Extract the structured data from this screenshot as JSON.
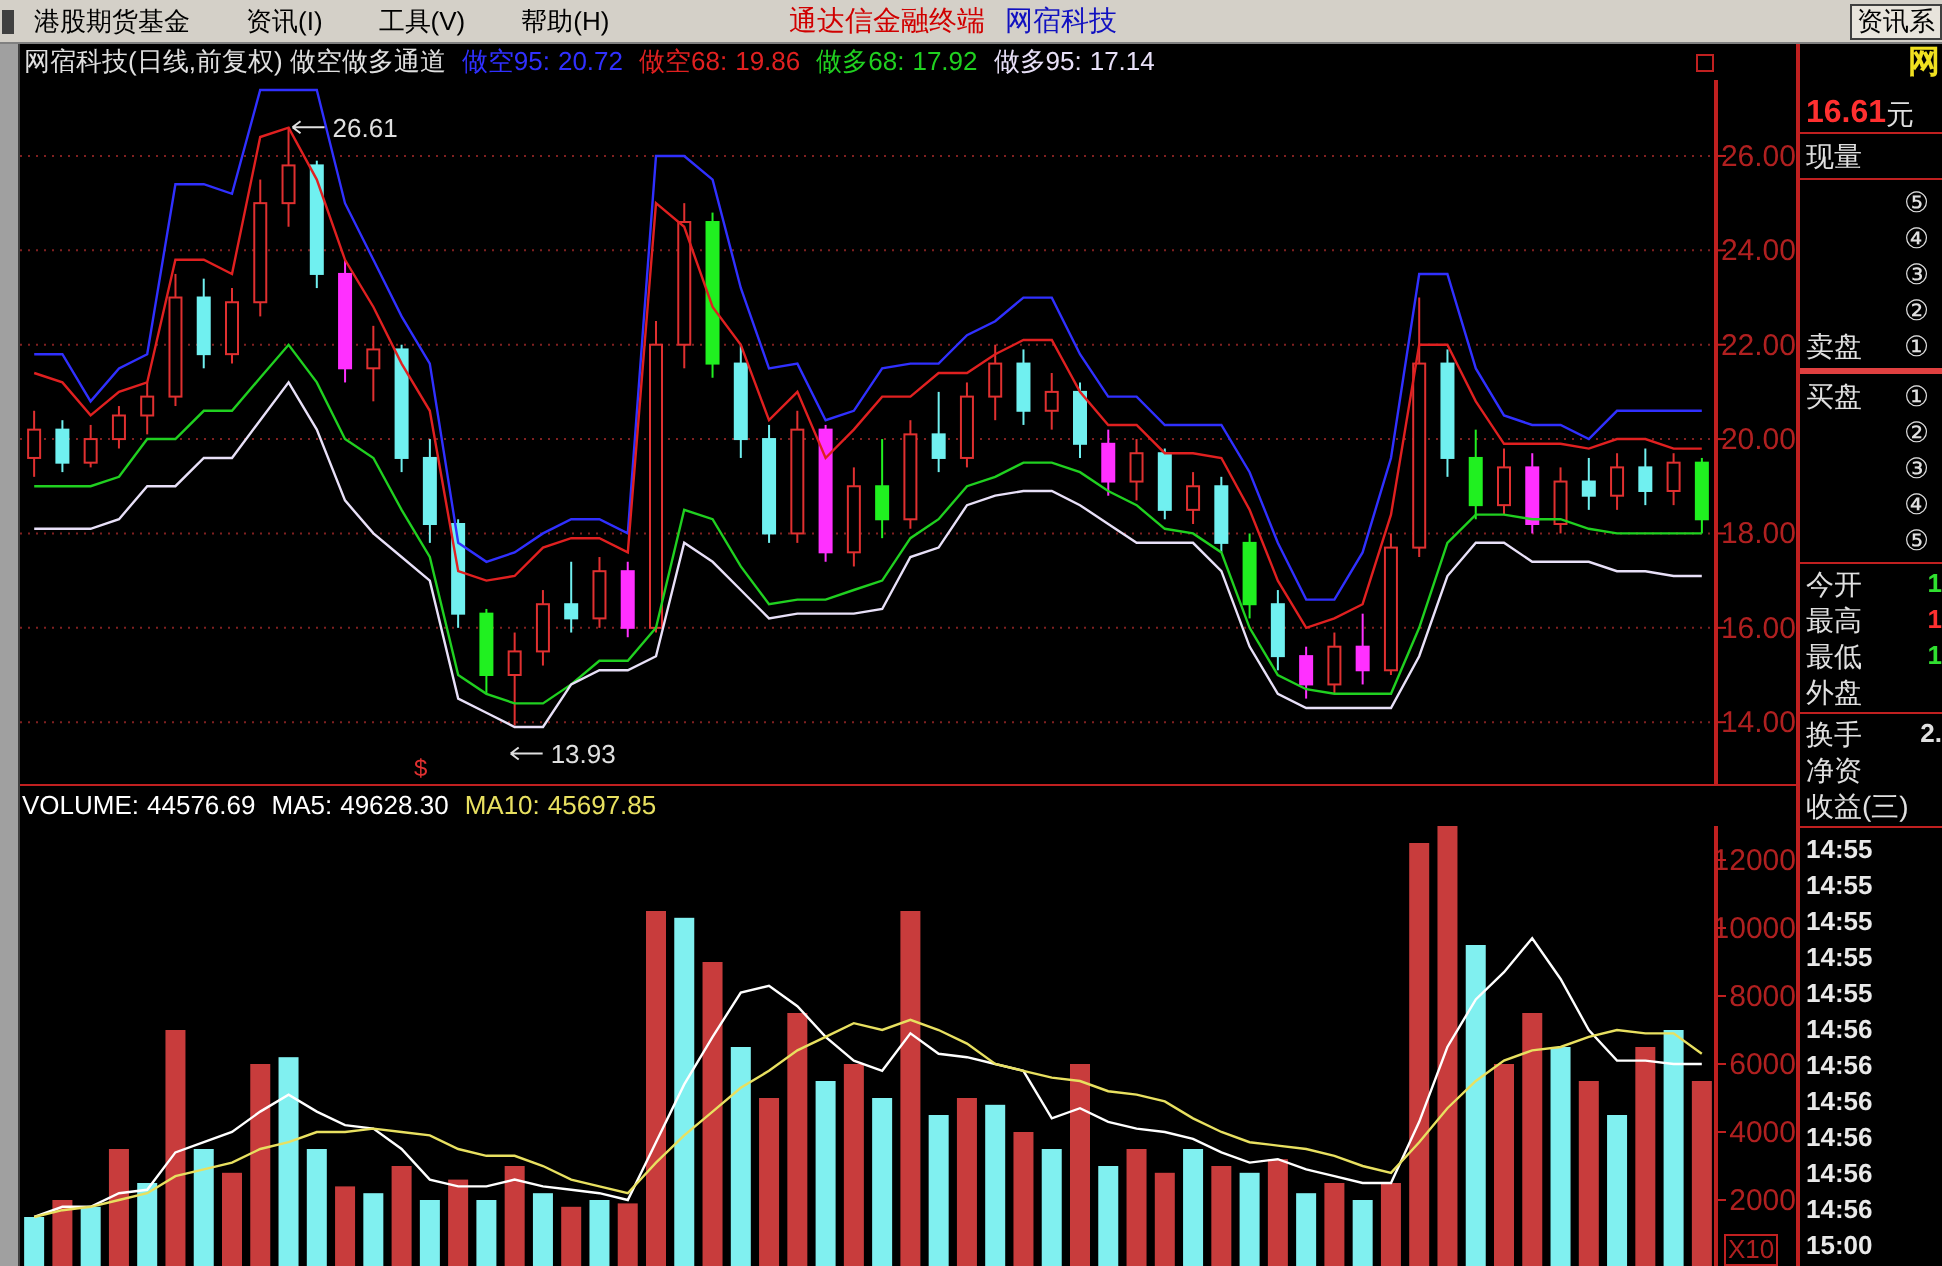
{
  "menu_bar": {
    "items": [
      "港股期货基金",
      "资讯(I)",
      "工具(V)",
      "帮助(H)"
    ],
    "app_title": "通达信金融终端",
    "stock_name": "网宿科技",
    "right_button": "资讯系"
  },
  "price_panel": {
    "title": "网宿科技(日线,前复权) 做空做多通道",
    "legend_values": [
      "20.72",
      "19.86",
      "17.92",
      "17.14"
    ],
    "chart_data": {
      "type": "candlestick",
      "grid": true,
      "categories": [
        null,
        null,
        null,
        null,
        null,
        null,
        null,
        null,
        null,
        null,
        null,
        null,
        null,
        null,
        null,
        null,
        null,
        null,
        null,
        null,
        null,
        null,
        null,
        null,
        null,
        null,
        null,
        null,
        null,
        null,
        null,
        null,
        null,
        null,
        null,
        null,
        null,
        null,
        null,
        null,
        null,
        null,
        null,
        null,
        null,
        null,
        null,
        null,
        null,
        null,
        null,
        null,
        null,
        null,
        null,
        null,
        null,
        null,
        null,
        null
      ],
      "ylim": [
        12.69,
        27.61
      ],
      "yticks": [
        {
          "value": 14,
          "label": "14.00"
        },
        {
          "value": 16,
          "label": "16.00"
        },
        {
          "value": 18,
          "label": "18.00"
        },
        {
          "value": 20,
          "label": "20.00"
        },
        {
          "value": 22,
          "label": "22.00"
        },
        {
          "value": 24,
          "label": "24.00"
        },
        {
          "value": 26,
          "label": "26.00"
        }
      ],
      "ohlc": [
        [
          19.6,
          20.6,
          19.2,
          20.2
        ],
        [
          20.2,
          20.4,
          19.3,
          19.5
        ],
        [
          19.5,
          20.3,
          19.4,
          20.0
        ],
        [
          20.0,
          20.7,
          19.8,
          20.5
        ],
        [
          20.5,
          21.2,
          20.1,
          20.9
        ],
        [
          20.9,
          23.5,
          20.7,
          23.0
        ],
        [
          23.0,
          23.4,
          21.5,
          21.8
        ],
        [
          21.8,
          23.2,
          21.6,
          22.9
        ],
        [
          22.9,
          25.5,
          22.6,
          25.0
        ],
        [
          25.0,
          26.61,
          24.5,
          25.8
        ],
        [
          25.8,
          25.9,
          23.2,
          23.5
        ],
        [
          23.5,
          23.8,
          21.2,
          21.5
        ],
        [
          21.5,
          22.4,
          20.8,
          21.9
        ],
        [
          21.9,
          22.0,
          19.3,
          19.6
        ],
        [
          19.6,
          20.0,
          17.8,
          18.2
        ],
        [
          18.2,
          18.3,
          16.0,
          16.3
        ],
        [
          16.3,
          16.4,
          14.6,
          15.0
        ],
        [
          15.0,
          15.9,
          13.93,
          15.5
        ],
        [
          15.5,
          16.8,
          15.2,
          16.5
        ],
        [
          16.5,
          17.4,
          15.9,
          16.2
        ],
        [
          16.2,
          17.5,
          16.0,
          17.2
        ],
        [
          17.2,
          17.4,
          15.8,
          16.0
        ],
        [
          16.0,
          22.5,
          15.9,
          22.0
        ],
        [
          22.0,
          25.0,
          21.5,
          24.6
        ],
        [
          24.6,
          24.8,
          21.3,
          21.6
        ],
        [
          21.6,
          22.0,
          19.6,
          20.0
        ],
        [
          20.0,
          20.3,
          17.8,
          18.0
        ],
        [
          18.0,
          20.6,
          17.8,
          20.2
        ],
        [
          20.2,
          20.3,
          17.4,
          17.6
        ],
        [
          17.6,
          19.4,
          17.3,
          19.0
        ],
        [
          19.0,
          20.0,
          17.9,
          18.3
        ],
        [
          18.3,
          20.4,
          18.1,
          20.1
        ],
        [
          20.1,
          21.0,
          19.3,
          19.6
        ],
        [
          19.6,
          21.2,
          19.4,
          20.9
        ],
        [
          20.9,
          22.0,
          20.4,
          21.6
        ],
        [
          21.6,
          21.9,
          20.3,
          20.6
        ],
        [
          20.6,
          21.4,
          20.2,
          21.0
        ],
        [
          21.0,
          21.2,
          19.6,
          19.9
        ],
        [
          19.9,
          20.2,
          18.8,
          19.1
        ],
        [
          19.1,
          20.0,
          18.7,
          19.7
        ],
        [
          19.7,
          19.8,
          18.3,
          18.5
        ],
        [
          18.5,
          19.3,
          18.2,
          19.0
        ],
        [
          19.0,
          19.2,
          17.6,
          17.8
        ],
        [
          17.8,
          18.0,
          16.2,
          16.5
        ],
        [
          16.5,
          16.8,
          15.1,
          15.4
        ],
        [
          15.4,
          15.6,
          14.5,
          14.8
        ],
        [
          14.8,
          15.9,
          14.6,
          15.6
        ],
        [
          15.6,
          16.3,
          14.8,
          15.1
        ],
        [
          15.1,
          18.0,
          15.0,
          17.7
        ],
        [
          17.7,
          23.0,
          17.5,
          21.6
        ],
        [
          21.6,
          21.9,
          19.2,
          19.6
        ],
        [
          19.6,
          20.2,
          18.3,
          18.6
        ],
        [
          18.6,
          19.8,
          18.4,
          19.4
        ],
        [
          19.4,
          19.7,
          18.0,
          18.2
        ],
        [
          18.2,
          19.4,
          18.0,
          19.1
        ],
        [
          19.1,
          19.6,
          18.5,
          18.8
        ],
        [
          18.8,
          19.7,
          18.5,
          19.4
        ],
        [
          19.4,
          19.8,
          18.6,
          18.9
        ],
        [
          18.9,
          19.7,
          18.6,
          19.5
        ],
        [
          19.5,
          19.6,
          18.0,
          18.3
        ]
      ],
      "colors": [
        "#e03030",
        "#70f0f0",
        "#e03030",
        "#e03030",
        "#e03030",
        "#e03030",
        "#70f0f0",
        "#e03030",
        "#e03030",
        "#e03030",
        "#70f0f0",
        "#ff30ff",
        "#e03030",
        "#70f0f0",
        "#70f0f0",
        "#70f0f0",
        "#20f020",
        "#e03030",
        "#e03030",
        "#70f0f0",
        "#e03030",
        "#ff30ff",
        "#e03030",
        "#e03030",
        "#20f020",
        "#70f0f0",
        "#70f0f0",
        "#e03030",
        "#ff30ff",
        "#e03030",
        "#20f020",
        "#e03030",
        "#70f0f0",
        "#e03030",
        "#e03030",
        "#70f0f0",
        "#e03030",
        "#70f0f0",
        "#ff30ff",
        "#e03030",
        "#70f0f0",
        "#e03030",
        "#70f0f0",
        "#20f020",
        "#70f0f0",
        "#ff30ff",
        "#e03030",
        "#ff30ff",
        "#e03030",
        "#e03030",
        "#70f0f0",
        "#20f020",
        "#e03030",
        "#ff30ff",
        "#e03030",
        "#70f0f0",
        "#e03030",
        "#70f0f0",
        "#e03030",
        "#20f020"
      ],
      "series": [
        {
          "name": "做空95:",
          "type": "line",
          "color": "#3030ff",
          "values": [
            21.8,
            21.8,
            20.8,
            21.5,
            21.8,
            25.4,
            25.4,
            25.2,
            27.4,
            27.4,
            27.4,
            25.0,
            23.8,
            22.6,
            21.6,
            17.8,
            17.4,
            17.6,
            18.0,
            18.3,
            18.3,
            18.0,
            26.0,
            26.0,
            25.5,
            23.2,
            21.5,
            21.6,
            20.4,
            20.6,
            21.5,
            21.6,
            21.6,
            22.2,
            22.5,
            23.0,
            23.0,
            21.8,
            20.9,
            20.9,
            20.3,
            20.3,
            20.3,
            19.3,
            17.8,
            16.6,
            16.6,
            17.6,
            19.6,
            23.5,
            23.5,
            21.5,
            20.5,
            20.3,
            20.3,
            20.0,
            20.6,
            20.6,
            20.6,
            20.6
          ]
        },
        {
          "name": "做空68:",
          "type": "line",
          "color": "#e02020",
          "values": [
            21.4,
            21.2,
            20.5,
            21.0,
            21.2,
            23.8,
            23.8,
            23.5,
            26.4,
            26.6,
            25.5,
            23.8,
            22.8,
            21.6,
            20.6,
            17.2,
            17.0,
            17.1,
            17.7,
            17.9,
            17.9,
            17.6,
            25.0,
            24.5,
            22.8,
            22.0,
            20.4,
            21.0,
            19.6,
            20.2,
            20.9,
            20.9,
            21.4,
            21.4,
            21.8,
            22.1,
            22.1,
            21.0,
            20.3,
            20.3,
            19.7,
            19.7,
            19.6,
            18.5,
            17.0,
            16.0,
            16.2,
            16.5,
            18.4,
            22.0,
            22.0,
            20.8,
            19.9,
            19.9,
            19.9,
            19.8,
            20.0,
            20.0,
            19.8,
            19.8
          ]
        },
        {
          "name": "做多68:",
          "type": "line",
          "color": "#20d020",
          "values": [
            19.0,
            19.0,
            19.0,
            19.2,
            20.0,
            20.0,
            20.6,
            20.6,
            21.3,
            22.0,
            21.2,
            20.0,
            19.6,
            18.5,
            17.5,
            15.0,
            14.6,
            14.4,
            14.4,
            14.8,
            15.3,
            15.3,
            16.0,
            18.5,
            18.3,
            17.3,
            16.5,
            16.6,
            16.6,
            16.8,
            17.0,
            17.9,
            18.3,
            19.0,
            19.2,
            19.5,
            19.5,
            19.3,
            18.9,
            18.6,
            18.1,
            18.0,
            17.6,
            16.0,
            15.0,
            14.7,
            14.6,
            14.6,
            14.6,
            16.0,
            17.8,
            18.4,
            18.4,
            18.3,
            18.3,
            18.1,
            18.0,
            18.0,
            18.0,
            18.0
          ]
        },
        {
          "name": "做多95:",
          "type": "line",
          "color": "#e8e0f8",
          "values": [
            18.1,
            18.1,
            18.1,
            18.3,
            19.0,
            19.0,
            19.6,
            19.6,
            20.4,
            21.2,
            20.2,
            18.7,
            18.0,
            17.5,
            17.0,
            14.5,
            14.2,
            13.9,
            13.9,
            14.8,
            15.1,
            15.1,
            15.4,
            17.8,
            17.4,
            16.8,
            16.2,
            16.3,
            16.3,
            16.3,
            16.4,
            17.5,
            17.7,
            18.6,
            18.8,
            18.9,
            18.9,
            18.6,
            18.2,
            17.8,
            17.8,
            17.8,
            17.2,
            15.6,
            14.6,
            14.3,
            14.3,
            14.3,
            14.3,
            15.4,
            17.1,
            17.8,
            17.8,
            17.4,
            17.4,
            17.4,
            17.2,
            17.2,
            17.1,
            17.1
          ]
        }
      ],
      "annotations": [
        "26.61",
        "13.93"
      ]
    },
    "signal_mark": "$"
  },
  "volume_panel": {
    "legend_values": [
      "44576.69",
      "49628.30",
      "45697.85"
    ],
    "scale_label": "X10",
    "chart_data": {
      "type": "bar",
      "categories": [
        null,
        null,
        null,
        null,
        null,
        null,
        null,
        null,
        null,
        null,
        null,
        null,
        null,
        null,
        null,
        null,
        null,
        null,
        null,
        null,
        null,
        null,
        null,
        null,
        null,
        null,
        null,
        null,
        null,
        null,
        null,
        null,
        null,
        null,
        null,
        null,
        null,
        null,
        null,
        null,
        null,
        null,
        null,
        null,
        null,
        null,
        null,
        null,
        null,
        null,
        null,
        null,
        null,
        null,
        null,
        null,
        null,
        null,
        null,
        null
      ],
      "ylim": [
        0,
        13000
      ],
      "yticks": [
        {
          "value": 2000,
          "label": "2000"
        },
        {
          "value": 4000,
          "label": "4000"
        },
        {
          "value": 6000,
          "label": "6000"
        },
        {
          "value": 8000,
          "label": "8000"
        },
        {
          "value": 10000,
          "label": "10000"
        },
        {
          "value": 12000,
          "label": "12000"
        }
      ],
      "series": [
        {
          "name": "VOLUME:",
          "color": "#ffffff",
          "colors": [
            "#80f0f0",
            "#c83c3c",
            "#80f0f0",
            "#c83c3c",
            "#80f0f0",
            "#c83c3c",
            "#80f0f0",
            "#c83c3c",
            "#c83c3c",
            "#80f0f0",
            "#80f0f0",
            "#c83c3c",
            "#80f0f0",
            "#c83c3c",
            "#80f0f0",
            "#c83c3c",
            "#80f0f0",
            "#c83c3c",
            "#80f0f0",
            "#c83c3c",
            "#80f0f0",
            "#c83c3c",
            "#c83c3c",
            "#80f0f0",
            "#c83c3c",
            "#80f0f0",
            "#c83c3c",
            "#c83c3c",
            "#80f0f0",
            "#c83c3c",
            "#80f0f0",
            "#c83c3c",
            "#80f0f0",
            "#c83c3c",
            "#80f0f0",
            "#c83c3c",
            "#80f0f0",
            "#c83c3c",
            "#80f0f0",
            "#c83c3c",
            "#c83c3c",
            "#80f0f0",
            "#c83c3c",
            "#80f0f0",
            "#c83c3c",
            "#80f0f0",
            "#c83c3c",
            "#80f0f0",
            "#c83c3c",
            "#c83c3c",
            "#c83c3c",
            "#80f0f0",
            "#c83c3c",
            "#c83c3c",
            "#80f0f0",
            "#c83c3c",
            "#80f0f0",
            "#c83c3c",
            "#80f0f0",
            "#c83c3c"
          ],
          "values": [
            1500,
            2000,
            1800,
            3500,
            2500,
            7000,
            3500,
            2800,
            6000,
            6200,
            3500,
            2400,
            2200,
            3000,
            2000,
            2600,
            2000,
            3000,
            2200,
            1800,
            2000,
            1900,
            10500,
            10300,
            9000,
            6500,
            5000,
            7500,
            5500,
            6000,
            5000,
            10500,
            4500,
            5000,
            4800,
            4000,
            3500,
            6000,
            3000,
            3500,
            2800,
            3500,
            3000,
            2800,
            3200,
            2200,
            2500,
            2000,
            2500,
            12500,
            13000,
            9500,
            6000,
            7500,
            6500,
            5500,
            4500,
            6500,
            7000,
            5500
          ]
        },
        {
          "name": "MA5:",
          "type": "line",
          "color": "#ffffff",
          "values": [
            1500,
            1800,
            1800,
            2200,
            2300,
            3400,
            3700,
            4000,
            4600,
            5100,
            4600,
            4200,
            4100,
            3500,
            2600,
            2400,
            2400,
            2600,
            2400,
            2300,
            2200,
            2000,
            3700,
            5400,
            6800,
            8100,
            8300,
            7700,
            6800,
            6100,
            5800,
            6900,
            6300,
            6200,
            6000,
            5800,
            4400,
            4700,
            4300,
            4100,
            4000,
            3800,
            3400,
            3100,
            3200,
            2900,
            2700,
            2500,
            2500,
            4300,
            6500,
            7900,
            8700,
            9700,
            8500,
            7000,
            6100,
            6100,
            6000,
            6000
          ]
        },
        {
          "name": "MA10:",
          "type": "line",
          "color": "#e8e060",
          "values": [
            1500,
            1700,
            1800,
            2000,
            2200,
            2700,
            2900,
            3100,
            3500,
            3700,
            4000,
            4000,
            4100,
            4000,
            3900,
            3500,
            3300,
            3300,
            3000,
            2600,
            2400,
            2200,
            3100,
            3900,
            4600,
            5300,
            5800,
            6400,
            6800,
            7200,
            7000,
            7300,
            7000,
            6600,
            6000,
            5800,
            5600,
            5500,
            5200,
            5100,
            4900,
            4400,
            4000,
            3700,
            3600,
            3500,
            3300,
            3000,
            2800,
            3700,
            4700,
            5500,
            6100,
            6400,
            6500,
            6800,
            7000,
            6900,
            6900,
            6300
          ]
        }
      ]
    }
  },
  "quote_panel": {
    "logo": "网",
    "price": "16.61",
    "price_unit": "元",
    "volume_label": "现量",
    "sell_label": "卖盘",
    "sell_levels": [
      "⑤",
      "④",
      "③",
      "②",
      "①"
    ],
    "buy_label": "买盘",
    "buy_levels": [
      "①",
      "②",
      "③",
      "④",
      "⑤"
    ],
    "stats": [
      {
        "label": "今开",
        "value": "1",
        "color": "#30e030"
      },
      {
        "label": "最高",
        "value": "1",
        "color": "#ff3030"
      },
      {
        "label": "最低",
        "value": "1",
        "color": "#30e030"
      },
      {
        "label": "外盘"
      }
    ],
    "stats2": [
      {
        "label": "换手",
        "value": "2."
      },
      {
        "label": "净资"
      },
      {
        "label": "收益(三)"
      }
    ],
    "ticks": [
      "14:55",
      "14:55",
      "14:55",
      "14:55",
      "14:55",
      "14:56",
      "14:56",
      "14:56",
      "14:56",
      "14:56",
      "14:56",
      "15:00"
    ]
  }
}
